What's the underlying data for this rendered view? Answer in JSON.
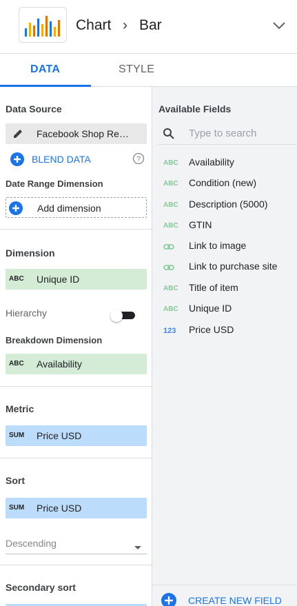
{
  "header": {
    "title": "Chart",
    "separator": "›",
    "subtitle": "Bar"
  },
  "tabs": [
    {
      "label": "DATA",
      "active": true
    },
    {
      "label": "STYLE",
      "active": false
    }
  ],
  "left": {
    "data_source": {
      "title": "Data Source",
      "value": "Facebook Shop Re…"
    },
    "blend": {
      "label": "BLEND DATA"
    },
    "date_range": {
      "title": "Date Range Dimension",
      "add_label": "Add dimension"
    },
    "dimension": {
      "title": "Dimension",
      "tag": "ABC",
      "value": "Unique ID"
    },
    "hierarchy": {
      "label": "Hierarchy",
      "enabled": false
    },
    "breakdown": {
      "title": "Breakdown Dimension",
      "tag": "ABC",
      "value": "Availability"
    },
    "metric": {
      "title": "Metric",
      "tag": "SUM",
      "value": "Price USD"
    },
    "sort": {
      "title": "Sort",
      "tag": "SUM",
      "value": "Price USD",
      "order": "Descending"
    },
    "secondary_sort": {
      "title": "Secondary sort"
    }
  },
  "right": {
    "title": "Available Fields",
    "search_placeholder": "Type to search",
    "fields": [
      {
        "type": "ABC",
        "label": "Availability"
      },
      {
        "type": "ABC",
        "label": "Condition (new)"
      },
      {
        "type": "ABC",
        "label": "Description (5000)"
      },
      {
        "type": "ABC",
        "label": "GTIN"
      },
      {
        "type": "link",
        "label": "Link to image"
      },
      {
        "type": "link",
        "label": "Link to purchase site"
      },
      {
        "type": "ABC",
        "label": "Title of item"
      },
      {
        "type": "ABC",
        "label": "Unique ID"
      },
      {
        "type": "123",
        "label": "Price USD"
      }
    ],
    "create_label": "CREATE NEW FIELD"
  },
  "colors": {
    "accent": "#1a73e8",
    "dimension_chip": "#d4ecd6",
    "metric_chip": "#bcdcfb",
    "field_text_type": "#81c995"
  }
}
